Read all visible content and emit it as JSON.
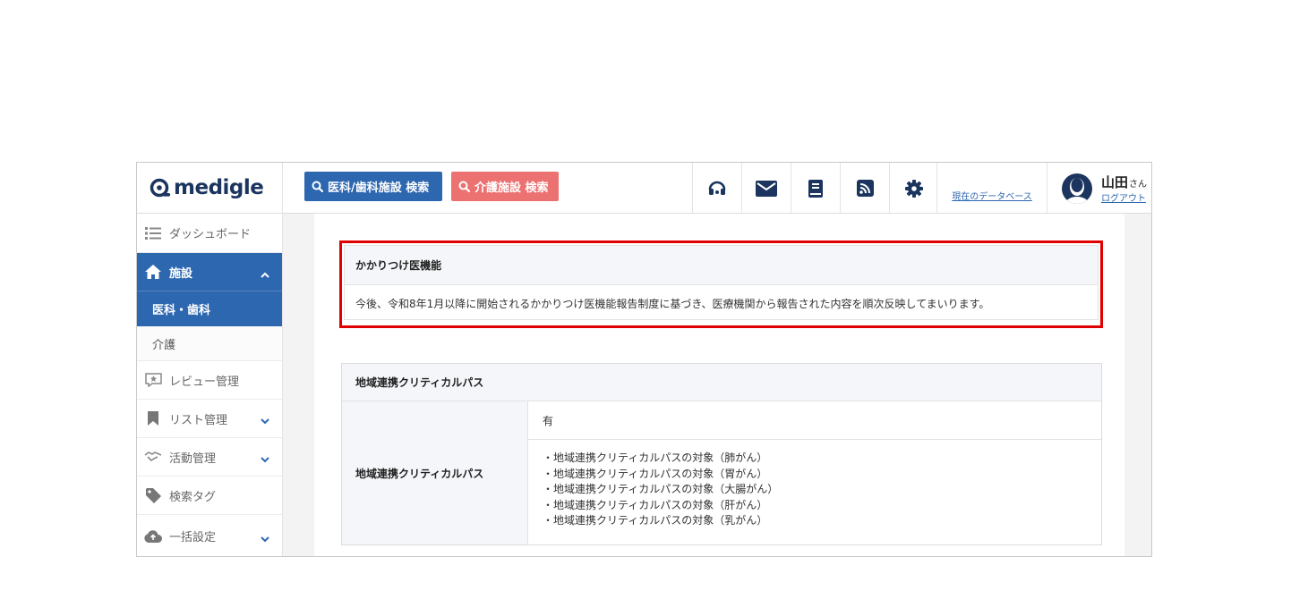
{
  "header": {
    "logo_text": "medigle",
    "search_medical_label": "医科/歯科施設 検索",
    "search_care_label": "介護施設 検索",
    "db_link": "現在のデータベース",
    "user_name": "山田",
    "user_suffix": "さん",
    "logout": "ログアウト",
    "icons": [
      "headset-icon",
      "mail-icon",
      "book-icon",
      "rss-icon",
      "gear-icon"
    ]
  },
  "sidebar": {
    "dashboard": "ダッシュボード",
    "facility": "施設",
    "medical": "医科・歯科",
    "care": "介護",
    "review": "レビュー管理",
    "list": "リスト管理",
    "activity": "活動管理",
    "tags": "検索タグ",
    "bulk": "一括設定"
  },
  "kakaritsuke": {
    "title": "かかりつけ医機能",
    "note": "今後、令和8年1月以降に開始されるかかりつけ医機能報告制度に基づき、医療機関から報告された内容を順次反映してまいります。"
  },
  "clinical_path": {
    "title": "地域連携クリティカルパス",
    "row_label": "地域連携クリティカルパス",
    "value": "有",
    "targets": [
      "・地域連携クリティカルパスの対象（肺がん）",
      "・地域連携クリティカルパスの対象（胃がん）",
      "・地域連携クリティカルパスの対象（大腸がん）",
      "・地域連携クリティカルパスの対象（肝がん）",
      "・地域連携クリティカルパスの対象（乳がん）"
    ]
  },
  "colors": {
    "brand_navy": "#1b355f",
    "primary_blue": "#2d67b0",
    "care_red": "#ec7171",
    "highlight_red": "#e00000"
  }
}
